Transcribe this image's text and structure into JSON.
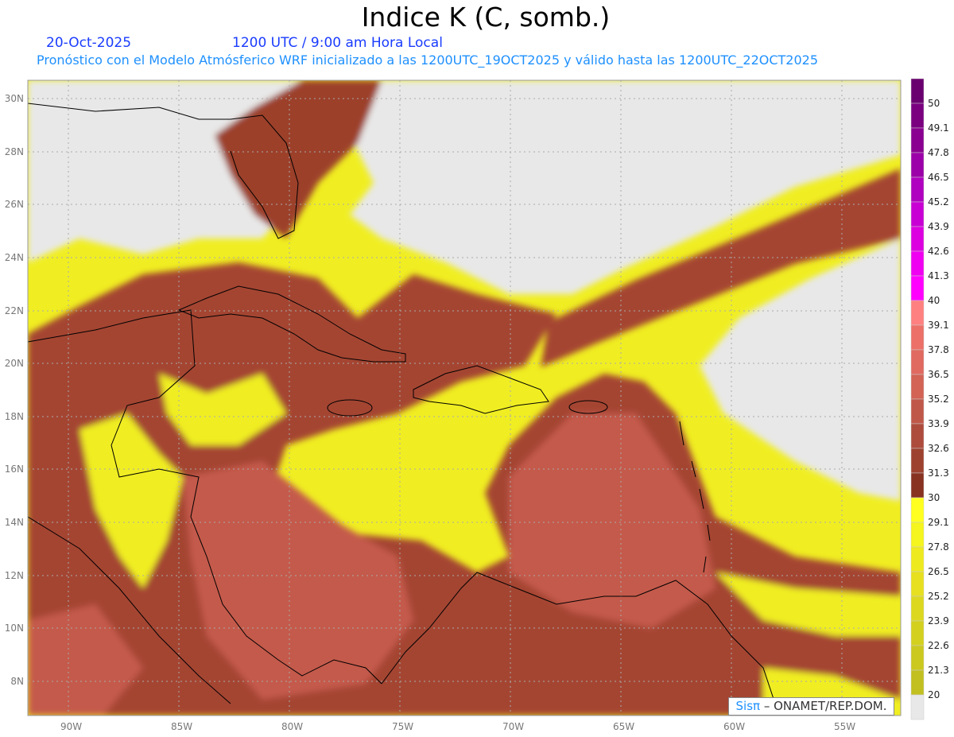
{
  "header": {
    "title": "Indice K (C, somb.)",
    "date": "20-Oct-2025",
    "time": "1200 UTC / 9:00 am Hora Local",
    "subtitle": "Pronóstico con el Modelo Atmósferico WRF inicializado a las 1200UTC_19OCT2025 y válido hasta las  1200UTC_22OCT2025"
  },
  "map": {
    "lon_labels": [
      "90W",
      "85W",
      "80W",
      "75W",
      "70W",
      "65W",
      "60W",
      "55W"
    ],
    "lat_labels": [
      "30N",
      "28N",
      "26N",
      "24N",
      "22N",
      "20N",
      "18N",
      "16N",
      "14N",
      "12N",
      "10N",
      "8N"
    ],
    "colors": {
      "missing": "#e8e8e8",
      "yellow": "#f5f520",
      "brown": "#9c3f2b",
      "red": "#c45a4c",
      "light_red": "#e07a6e"
    }
  },
  "colorbar": {
    "labels": [
      "50",
      "49.1",
      "47.8",
      "46.5",
      "45.2",
      "43.9",
      "42.6",
      "41.3",
      "40",
      "39.1",
      "37.8",
      "36.5",
      "35.2",
      "33.9",
      "32.6",
      "31.3",
      "30",
      "29.1",
      "27.8",
      "26.5",
      "25.2",
      "23.9",
      "22.6",
      "21.3",
      "20"
    ],
    "colors": [
      "#6a0070",
      "#7a0080",
      "#8a0090",
      "#9c00a8",
      "#b000c0",
      "#c800d4",
      "#dc00e0",
      "#f000f0",
      "#ff00ff",
      "#ff8080",
      "#ec7068",
      "#e06a60",
      "#d26355",
      "#c0584a",
      "#ad4c3d",
      "#9e4230",
      "#883222",
      "#ffff20",
      "#f5f520",
      "#eeea20",
      "#e6e020",
      "#dcd820",
      "#d4d020",
      "#cbc820",
      "#c2c020",
      "#e8e8e8"
    ]
  },
  "credit": {
    "logo": "Sisπ",
    "text": "– ONAMET/REP.DOM."
  }
}
